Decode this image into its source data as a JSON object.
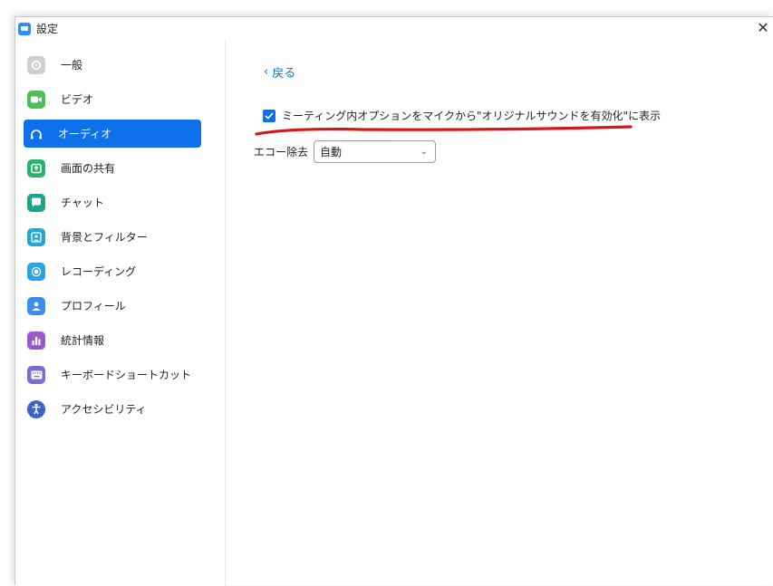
{
  "window": {
    "title": "設定"
  },
  "sidebar": {
    "items": [
      {
        "label": "一般",
        "icon": "gear-icon",
        "color": "#c8c8c8"
      },
      {
        "label": "ビデオ",
        "icon": "video-icon",
        "color": "#4fbd5c"
      },
      {
        "label": "オーディオ",
        "icon": "headphones-icon",
        "color": "#0e71eb",
        "active": true
      },
      {
        "label": "画面の共有",
        "icon": "share-screen-icon",
        "color": "#28b36f"
      },
      {
        "label": "チャット",
        "icon": "chat-icon",
        "color": "#1ea48a"
      },
      {
        "label": "背景とフィルター",
        "icon": "background-icon",
        "color": "#28a8c9"
      },
      {
        "label": "レコーディング",
        "icon": "record-icon",
        "color": "#2aa4e8"
      },
      {
        "label": "プロフィール",
        "icon": "profile-icon",
        "color": "#3d8cf2"
      },
      {
        "label": "統計情報",
        "icon": "stats-icon",
        "color": "#9b59c9"
      },
      {
        "label": "キーボードショートカット",
        "icon": "keyboard-icon",
        "color": "#7b6cd6"
      },
      {
        "label": "アクセシビリティ",
        "icon": "accessibility-icon",
        "color": "#3f63c8"
      }
    ]
  },
  "content": {
    "back_label": "戻る",
    "option": {
      "checked": true,
      "label": "ミーティング内オプションをマイクから\"オリジナルサウンドを有効化\"に表示"
    },
    "echo": {
      "label": "エコー除去",
      "value": "自動"
    }
  },
  "colors": {
    "accent": "#0e71eb",
    "underline": "#d9141b"
  }
}
